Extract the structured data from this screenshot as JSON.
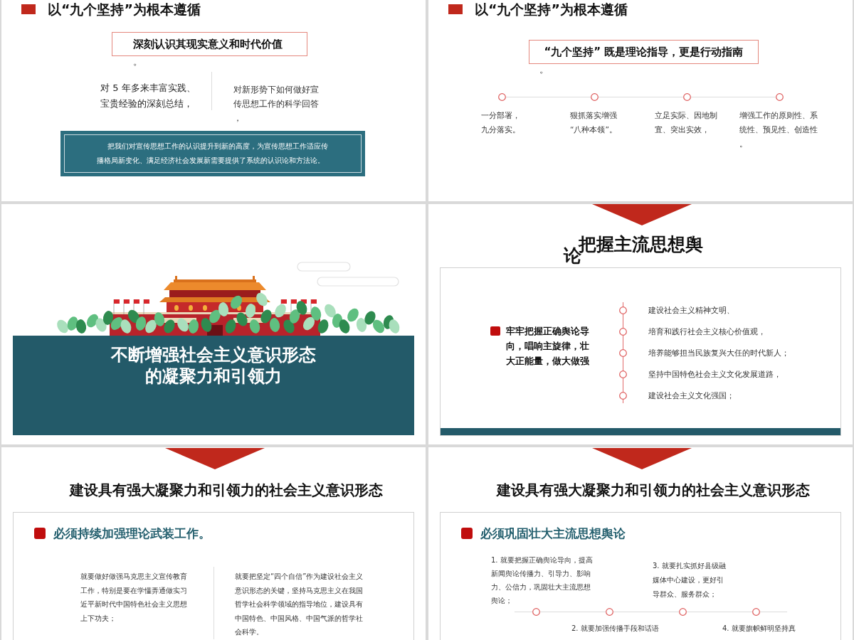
{
  "slides": [
    {
      "kind": "text_columns",
      "title": "以“九个坚持”为根本遵循",
      "heading": "深刻认识其现实意义和时代价值",
      "heading_tail": "。",
      "columns": [
        "对 5 年多来丰富实践、宝贵经验的深刻总结，",
        "对新形势下如何做好宣传思想工作的科学回答，"
      ],
      "callout": "把我们对宣传思想工作的认识提升到新的高度，为宣传思想工作适应传播格局新变化、满足经济社会发展新需要提供了系统的认识论和方法论。"
    },
    {
      "kind": "node_timeline",
      "title": "以“九个坚持”为根本遵循",
      "heading": "“九个坚持” 既是理论指导，更是行动指南",
      "heading_tail": "。",
      "points": [
        "一分部署，九分落实。",
        "狠抓落实增强“八种本领”。",
        "立足实际、因地制宜、突出实效，",
        "增强工作的原则性、系统性、预见性、创造性。"
      ]
    },
    {
      "kind": "section_cover",
      "title": "不断增强社会主义意识形态的凝聚力和引领力"
    },
    {
      "kind": "vertical_list",
      "title": "把握主流思想舆论",
      "lead": "牢牢把握正确舆论导向，唱响主旋律，壮大正能量，做大做强",
      "items": [
        "建设社会主义精神文明、",
        "培育和践行社会主义核心价值观，",
        "培养能够担当民族复兴大任的时代新人；",
        "坚持中国特色社会主义文化发展道路，",
        "建设社会主义文化强国；"
      ]
    },
    {
      "kind": "two_column_card",
      "title": "建设具有强大凝聚力和引领力的社会主义意识形态",
      "heading": "必须持续加强理论武装工作。",
      "columns": [
        "就要做好做强马克思主义宣传教育工作，特别是要在学懂弄通做实习近平新时代中国特色社会主义思想上下功夫；",
        "就要把坚定“四个自信”作为建设社会主义意识形态的关键，坚持马克思主义在我国哲学社会科学领域的指导地位，建设具有中国特色、中国风格、中国气派的哲学社会科学。"
      ]
    },
    {
      "kind": "zigzag_timeline",
      "title": "建设具有强大凝聚力和引领力的社会主义意识形态",
      "heading": "必须巩固壮大主流思想舆论",
      "points": [
        "1. 就要把握正确舆论导向，提高新闻舆论传播力、引导力、影响力、公信力，巩固壮大主流思想舆论；",
        "2. 就要加强传播手段和话语",
        "3. 就要扎实抓好县级融媒体中心建设，更好引导群众、服务群众；",
        "4. 就要旗帜鲜明坚持真"
      ]
    }
  ]
}
